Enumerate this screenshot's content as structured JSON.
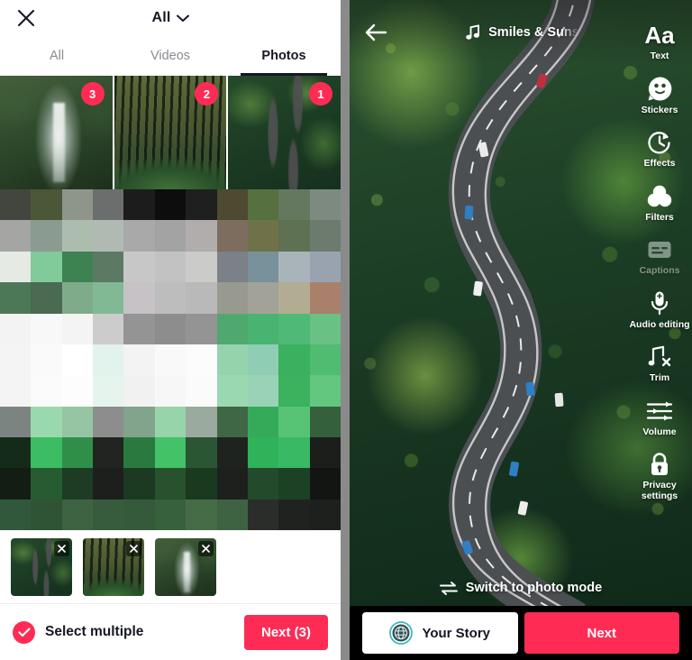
{
  "accent_colors": {
    "brand_red": "#FE2C55",
    "dark_text": "#161823",
    "muted_text": "#8A8B91",
    "story_icon_teal": "#3FB6BF"
  },
  "picker": {
    "close_icon": "close-icon",
    "filter": {
      "label": "All",
      "chevron_icon": "chevron-down-icon"
    },
    "tabs": [
      {
        "label": "All",
        "active": false
      },
      {
        "label": "Videos",
        "active": false
      },
      {
        "label": "Photos",
        "active": true
      }
    ],
    "thumbnails": [
      {
        "name": "waterfall",
        "badge": "3",
        "selected": false
      },
      {
        "name": "forest",
        "badge": "2",
        "selected": false
      },
      {
        "name": "aerial-road",
        "badge": "1",
        "selected": true
      }
    ],
    "selected_strip": [
      {
        "name": "aerial-road",
        "remove_icon": "close-icon"
      },
      {
        "name": "forest",
        "remove_icon": "close-icon"
      },
      {
        "name": "waterfall",
        "remove_icon": "close-icon"
      }
    ],
    "footer": {
      "select_multiple_label": "Select multiple",
      "select_multiple_checked": true,
      "check_icon": "check-icon",
      "next_label": "Next (3)"
    },
    "mosaic": {
      "columns": 11,
      "rows": [
        [
          "#43453f",
          "#4b5737",
          "#8e968c",
          "#6b6e6d",
          "#1c1c1c",
          "#0d0d0d",
          "#1e1f1e",
          "#4e4a32",
          "#567040",
          "#64775f",
          "#7d8a80"
        ],
        [
          "#a5a5a3",
          "#8a9c91",
          "#adbdad",
          "#b0bab3",
          "#a9a9a9",
          "#a3a3a3",
          "#b0adac",
          "#7d6d5e",
          "#6f7249",
          "#5e7152",
          "#6d7a6e"
        ],
        [
          "#e6eae5",
          "#80cb99",
          "#3f8252",
          "#5c7964",
          "#c7c7c7",
          "#c2c2c2",
          "#cbcbc9",
          "#7b8089",
          "#78919b",
          "#a9b4ba",
          "#99a3b0"
        ],
        [
          "#4c7857",
          "#4a6a52",
          "#80ab8b",
          "#81b994",
          "#c6c2c6",
          "#bdbdbd",
          "#b9b9b9",
          "#999a8f",
          "#a2a298",
          "#b2ac93",
          "#a9806a"
        ],
        [
          "#f3f3f3",
          "#f8f8f8",
          "#f4f4f4",
          "#cccccc",
          "#949494",
          "#8d8d8d",
          "#949494",
          "#4fa96e",
          "#49b472",
          "#4fb978",
          "#69c184"
        ],
        [
          "#f4f4f4",
          "#fafafa",
          "#ffffff",
          "#e2f2ec",
          "#f3f3f3",
          "#f9f9f9",
          "#fcfcfc",
          "#95d3ad",
          "#8fcdb4",
          "#3bb05f",
          "#4fbc71"
        ],
        [
          "#f4f4f4",
          "#fbfbfb",
          "#fdfdfd",
          "#e6f4ee",
          "#f1f1f1",
          "#f7f7f7",
          "#fbfbfb",
          "#9ad8b1",
          "#9ad2b6",
          "#3cb25f",
          "#63c77f"
        ],
        [
          "#7b8480",
          "#9ad9ad",
          "#95c5a2",
          "#8d8d8d",
          "#82a38c",
          "#97d4a9",
          "#9aaa9e",
          "#3f6746",
          "#35ab5a",
          "#57c374",
          "#35603c"
        ],
        [
          "#132b18",
          "#3cbc63",
          "#2f8f49",
          "#212421",
          "#2a7a3f",
          "#43c268",
          "#2b5634",
          "#1f231f",
          "#2fb35a",
          "#39b963",
          "#1b1e1b"
        ],
        [
          "#141d14",
          "#275c33",
          "#1d3c23",
          "#1c1f1c",
          "#1b3a21",
          "#28522e",
          "#1a3a20",
          "#1d201d",
          "#234a2a",
          "#1d4124",
          "#121512"
        ],
        [
          "#31583a",
          "#2e5435",
          "#3d6343",
          "#375c3d",
          "#355a3b",
          "#37603d",
          "#456b47",
          "#3e6343",
          "#2a2d2a",
          "#1f221f",
          "#1d201d"
        ]
      ]
    }
  },
  "editor": {
    "back_icon": "back-arrow-icon",
    "music": {
      "icon": "music-note-icon",
      "title": "Smiles & Suns"
    },
    "tools": [
      {
        "label": "Text",
        "icon": "text-aa-icon",
        "disabled": false
      },
      {
        "label": "Stickers",
        "icon": "sticker-smiley-icon",
        "disabled": false
      },
      {
        "label": "Effects",
        "icon": "effects-clock-icon",
        "disabled": false
      },
      {
        "label": "Filters",
        "icon": "filters-circles-icon",
        "disabled": false
      },
      {
        "label": "Captions",
        "icon": "captions-icon",
        "disabled": true
      },
      {
        "label": "Audio editing",
        "icon": "microphone-icon",
        "disabled": false
      },
      {
        "label": "Trim",
        "icon": "trim-note-x-icon",
        "disabled": false
      },
      {
        "label": "Volume",
        "icon": "volume-sliders-icon",
        "disabled": false
      },
      {
        "label": "Privacy settings",
        "icon": "lock-icon",
        "disabled": false
      }
    ],
    "switch_mode": {
      "label": "Switch to photo mode",
      "icon": "swap-arrows-icon"
    },
    "actions": {
      "story_label": "Your Story",
      "story_icon": "story-globe-icon",
      "next_label": "Next"
    }
  }
}
